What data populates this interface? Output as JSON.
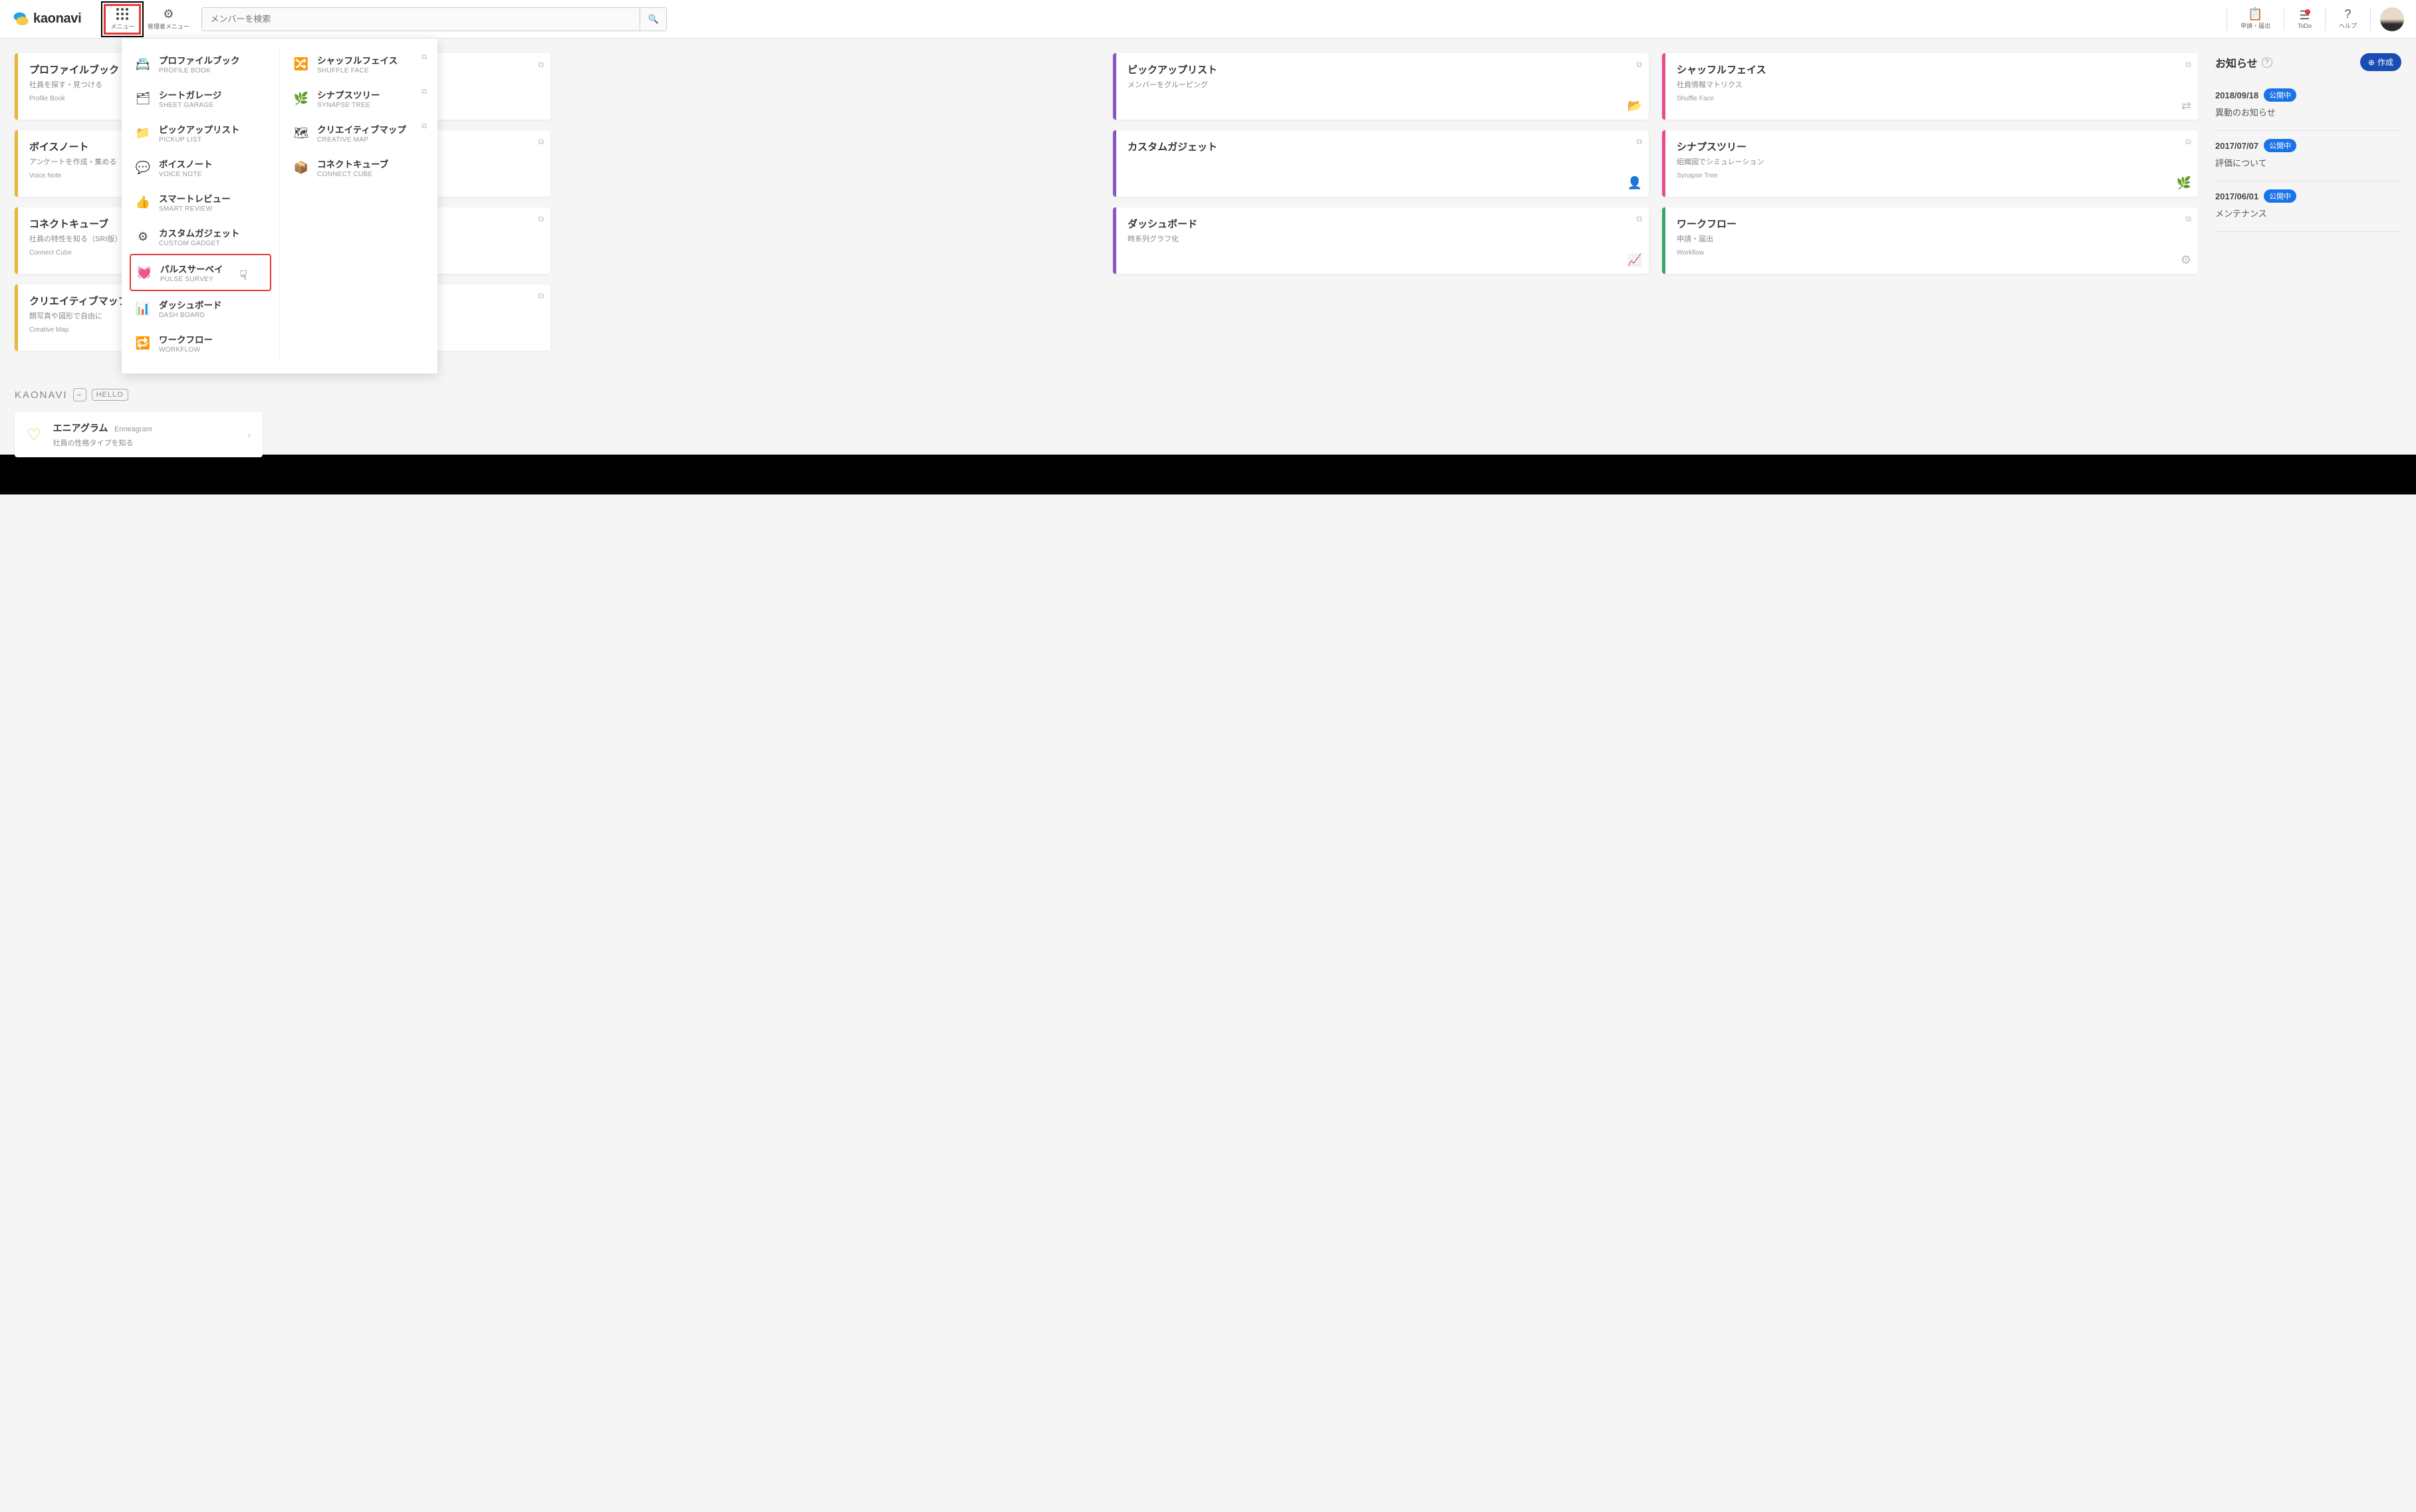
{
  "brand": "kaonavi",
  "header": {
    "menu_label": "メニュー",
    "admin_label": "管理者メニュー",
    "search_placeholder": "メンバーを検索",
    "nav": {
      "apply": "申請・届出",
      "todo": "ToDo",
      "help": "ヘルプ"
    }
  },
  "cards": [
    {
      "jp": "プロファイルブック",
      "desc": "社員を探す・見つける",
      "en": "Profile Book",
      "color": "#e6b73a"
    },
    {
      "jp": "ピックアップリスト",
      "desc": "メンバーをグルーピング",
      "en": "",
      "color": "#8856c1"
    },
    {
      "jp": "シャッフルフェイス",
      "desc": "社員情報マトリクス",
      "en": "Shuffle Face",
      "color": "#e84a8f"
    },
    {
      "jp": "ボイスノート",
      "desc": "アンケートを作成・集める",
      "en": "Voice Note",
      "color": "#e6b73a"
    },
    {
      "jp": "カスタムガジェット",
      "desc": "",
      "en": "",
      "color": "#8856c1"
    },
    {
      "jp": "シナプスツリー",
      "desc": "組織図でシミュレーション",
      "en": "Synapse Tree",
      "color": "#e84a8f"
    },
    {
      "jp": "コネクトキューブ",
      "desc": "社員の特性を知る（SRI版）",
      "en": "Connect Cube",
      "color": "#e6b73a"
    },
    {
      "jp": "ダッシュボード",
      "desc": "時系列グラフ化",
      "en": "",
      "color": "#8856c1"
    },
    {
      "jp": "ワークフロー",
      "desc": "申請・届出",
      "en": "Workflow",
      "color": "#2ea86b"
    },
    {
      "jp": "クリエイティブマップ",
      "desc": "顔写真や図形で自由に",
      "en": "Creative Map",
      "color": "#e6b73a"
    }
  ],
  "hello": {
    "brand": "KAONAVI",
    "badge": "HELLO",
    "item_title": "エニアグラム",
    "item_sub": "Enneagram",
    "item_desc": "社員の性格タイプを知る"
  },
  "notices": {
    "heading": "お知らせ",
    "create": "作成",
    "items": [
      {
        "date": "2018/09/18",
        "status": "公開中",
        "title": "異動のお知らせ"
      },
      {
        "date": "2017/07/07",
        "status": "公開中",
        "title": "評価について"
      },
      {
        "date": "2017/06/01",
        "status": "公開中",
        "title": "メンテナンス"
      }
    ]
  },
  "menu": {
    "col1": [
      {
        "jp": "プロファイルブック",
        "en": "PROFILE BOOK",
        "icon": "📇"
      },
      {
        "jp": "シートガレージ",
        "en": "SHEET GARAGE",
        "icon": "🗂"
      },
      {
        "jp": "ピックアップリスト",
        "en": "PICKUP LIST",
        "icon": "📁"
      },
      {
        "jp": "ボイスノート",
        "en": "VOICE NOTE",
        "icon": "💬"
      },
      {
        "jp": "スマートレビュー",
        "en": "SMART REVIEW",
        "icon": "👍"
      },
      {
        "jp": "カスタムガジェット",
        "en": "CUSTOM GADGET",
        "icon": "⚙"
      },
      {
        "jp": "パルスサーベイ",
        "en": "PULSE SURVEY",
        "icon": "💓",
        "highlight": true
      },
      {
        "jp": "ダッシュボード",
        "en": "DASH BOARD",
        "icon": "📊"
      },
      {
        "jp": "ワークフロー",
        "en": "WORKFLOW",
        "icon": "🔁"
      }
    ],
    "col2": [
      {
        "jp": "シャッフルフェイス",
        "en": "SHUFFLE FACE",
        "icon": "🔀",
        "ext": true
      },
      {
        "jp": "シナプスツリー",
        "en": "SYNAPSE TREE",
        "icon": "🌿",
        "ext": true
      },
      {
        "jp": "クリエイティブマップ",
        "en": "CREATIVE MAP",
        "icon": "🗺",
        "ext": true
      },
      {
        "jp": "コネクトキューブ",
        "en": "CONNECT CUBE",
        "icon": "📦"
      }
    ]
  }
}
